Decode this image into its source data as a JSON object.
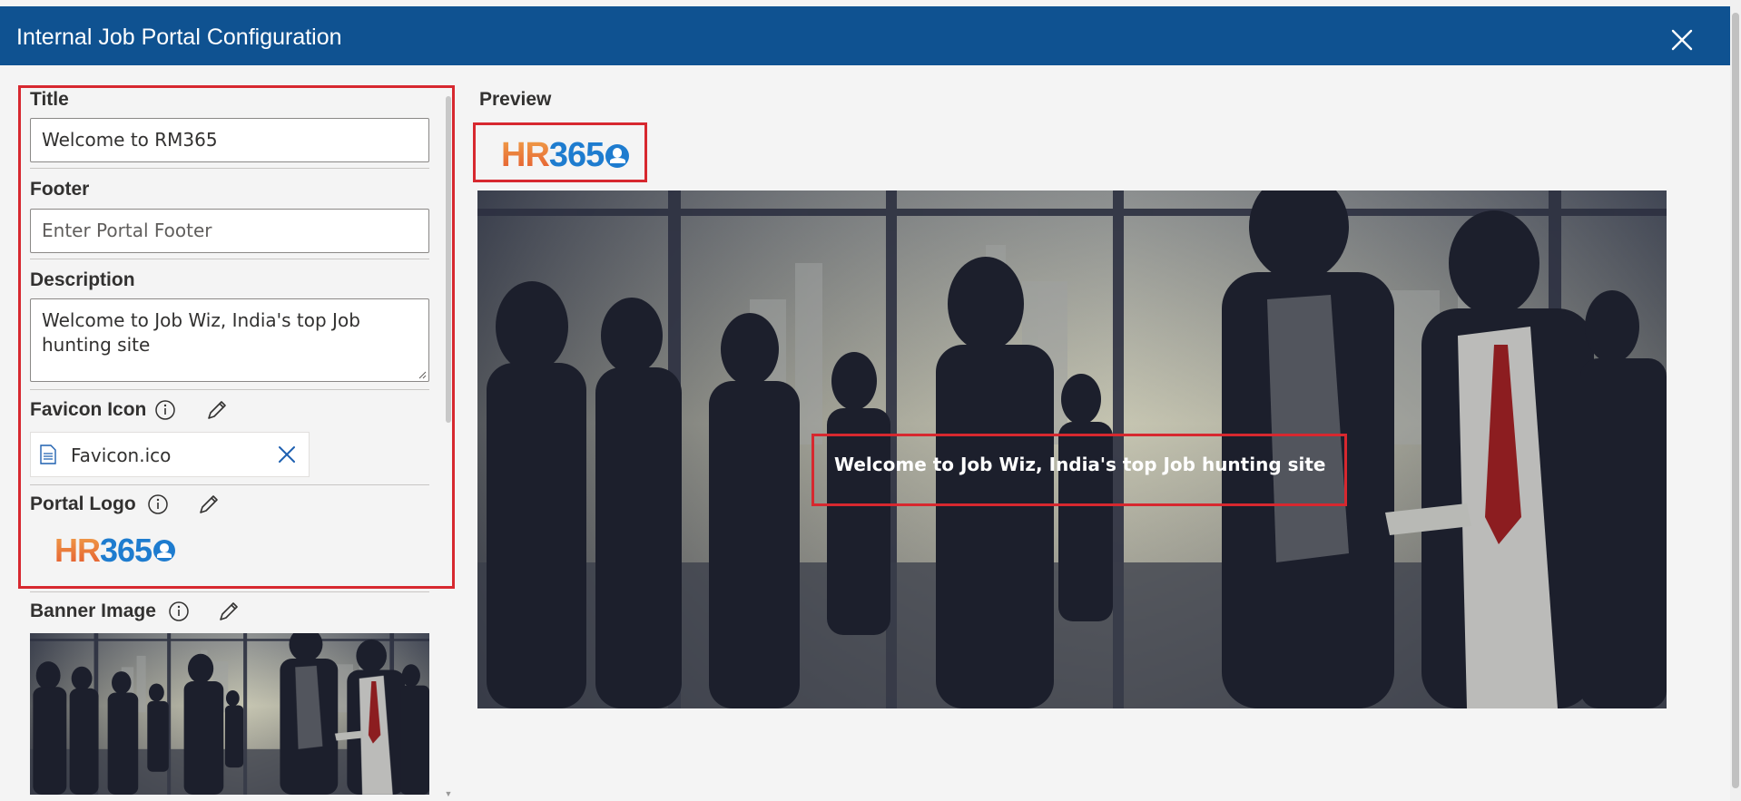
{
  "header": {
    "title": "Internal Job Portal Configuration",
    "close_icon": "close-icon"
  },
  "form": {
    "title": {
      "label": "Title",
      "value": "Welcome to RM365"
    },
    "footer": {
      "label": "Footer",
      "placeholder": "Enter Portal Footer",
      "value": ""
    },
    "description": {
      "label": "Description",
      "value": "Welcome to Job Wiz, India's top Job hunting site"
    },
    "favicon": {
      "label": "Favicon Icon",
      "file_name": "Favicon.ico",
      "info_icon": "info-icon",
      "edit_icon": "pencil-icon",
      "remove_icon": "close-icon",
      "file_icon": "document-icon"
    },
    "portal_logo": {
      "label": "Portal Logo",
      "info_icon": "info-icon",
      "edit_icon": "pencil-icon"
    },
    "banner_image": {
      "label": "Banner Image",
      "info_icon": "info-icon",
      "edit_icon": "pencil-icon"
    }
  },
  "logo": {
    "part1": "HR",
    "part2": "365"
  },
  "preview": {
    "label": "Preview",
    "banner_text": "Welcome to Job Wiz, India's top Job hunting site"
  },
  "colors": {
    "header_bg": "#0f5291",
    "highlight": "#d7282f",
    "logo_orange": "#e4572e",
    "logo_blue": "#1e7ccf"
  }
}
